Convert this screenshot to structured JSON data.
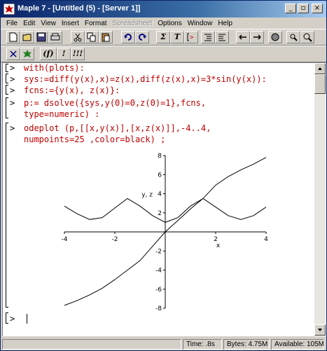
{
  "window": {
    "title": "Maple 7 - [Untitled (5) - [Server 1]]",
    "controls": {
      "minimize": "_",
      "restore": "▫",
      "close": "×"
    }
  },
  "menu": [
    "File",
    "Edit",
    "View",
    "Insert",
    "Format",
    "Spreadsheet",
    "Options",
    "Window",
    "Help"
  ],
  "toolbar2": {
    "func_label": "(f)",
    "exclam": "!",
    "triple_exclam": "!!!"
  },
  "worksheet": {
    "prompt": ">",
    "lines": [
      "with(plots):",
      "sys:=diff(y(x),x)=z(x),diff(z(x),x)=3*sin(y(x)):",
      "fcns:={y(x), z(x)}:",
      "p:= dsolve({sys,y(0)=0,z(0)=1},fcns,",
      "type=numeric) :",
      "odeplot (p,[[x,y(x)],[x,z(x)]],-4..4,",
      "numpoints=25 ,color=black) ;"
    ]
  },
  "chart_data": {
    "type": "line",
    "title": "",
    "xlabel": "x",
    "ylabel": "y, z",
    "xlim": [
      -4,
      4
    ],
    "ylim": [
      -8,
      8
    ],
    "xticks": [
      -4,
      -2,
      2,
      4
    ],
    "yticks": [
      -8,
      -6,
      -4,
      -2,
      2,
      4,
      6,
      8
    ],
    "series": [
      {
        "x": [
          -4,
          -3.5,
          -3,
          -2.5,
          -2,
          -1.5,
          -1,
          -0.5,
          0,
          0.5,
          1,
          1.5,
          2,
          2.5,
          3,
          3.5,
          4
        ],
        "values": [
          -7.7,
          -7.2,
          -6.6,
          -5.9,
          -5.0,
          -4.0,
          -3.0,
          -1.5,
          0,
          1.2,
          2.4,
          3.5,
          4.9,
          5.8,
          6.5,
          7.1,
          7.8
        ]
      },
      {
        "x": [
          -4,
          -3.5,
          -3,
          -2.5,
          -2,
          -1.5,
          -1,
          -0.5,
          0,
          0.5,
          1,
          1.5,
          2,
          2.5,
          3,
          3.5,
          4
        ],
        "values": [
          2.7,
          1.9,
          1.3,
          1.5,
          2.5,
          3.5,
          2.7,
          1.7,
          1.0,
          1.5,
          2.7,
          3.5,
          2.6,
          1.7,
          1.3,
          1.7,
          2.6
        ]
      }
    ]
  },
  "status": {
    "time": "Time: .8s",
    "bytes": "Bytes: 4.75M",
    "available": "Available: 105M"
  }
}
